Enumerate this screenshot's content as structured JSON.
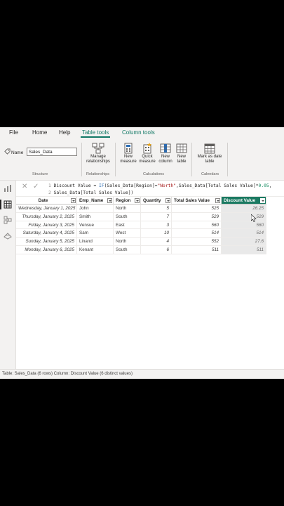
{
  "menu": {
    "items": [
      {
        "label": "File"
      },
      {
        "label": "Home"
      },
      {
        "label": "Help"
      },
      {
        "label": "Table tools"
      },
      {
        "label": "Column tools"
      }
    ],
    "active_index": 3
  },
  "ribbon": {
    "structure": {
      "name_label": "Name",
      "name_value": "Sales_Data",
      "group_label": "Structure"
    },
    "relationships": {
      "button_line1": "Manage",
      "button_line2": "relationships",
      "group_label": "Relationships"
    },
    "calculations": {
      "new_measure": {
        "line1": "New",
        "line2": "measure"
      },
      "quick_measure": {
        "line1": "Quick",
        "line2": "measure"
      },
      "new_column": {
        "line1": "New",
        "line2": "column"
      },
      "new_table": {
        "line1": "New",
        "line2": "table"
      },
      "group_label": "Calculations"
    },
    "calendars": {
      "button_line1": "Mark as date",
      "button_line2": "table",
      "group_label": "Calendars"
    }
  },
  "formula": {
    "line1_num": "1",
    "line1_a": "Discount Value = ",
    "line1_kw": "IF",
    "line1_b": "(Sales_Data[Region]=",
    "line1_str": "\"North\"",
    "line1_c": ",Sales_Data[Total Sales Value]*",
    "line1_num_val": "0.05",
    "line1_d": ",",
    "line2_num": "2",
    "line2_text": "Sales_Data[Total Sales Value])"
  },
  "table": {
    "columns": [
      "Date",
      "Emp_Name",
      "Region",
      "Quantity",
      "Total Sales Value",
      "Discount Value"
    ],
    "selected_column": 5,
    "rows": [
      [
        "Wednesday, January 1, 2025",
        "John",
        "North",
        "5",
        "525",
        "26.25"
      ],
      [
        "Thursday, January 2, 2025",
        "Smith",
        "South",
        "7",
        "529",
        "529"
      ],
      [
        "Friday, January 3, 2025",
        "Vensue",
        "East",
        "3",
        "560",
        "560"
      ],
      [
        "Saturday, January 4, 2025",
        "Sam",
        "West",
        "10",
        "514",
        "514"
      ],
      [
        "Sunday, January 5, 2025",
        "Linand",
        "North",
        "4",
        "552",
        "27.6"
      ],
      [
        "Monday, January 6, 2025",
        "Kenant",
        "South",
        "6",
        "511",
        "511"
      ]
    ]
  },
  "status": {
    "text": "Table: Sales_Data (6 rows) Column: Discount Value (6 distinct values)"
  },
  "colors": {
    "accent": "#117865",
    "selected_header": "#1b7a62"
  },
  "icons": [
    "tag-icon",
    "manage-relationships-icon",
    "new-measure-icon",
    "quick-measure-icon",
    "new-column-icon",
    "new-table-icon",
    "mark-date-table-icon",
    "report-view-icon",
    "table-view-icon",
    "model-view-icon",
    "dax-query-view-icon",
    "cancel-icon",
    "check-icon",
    "dropdown-icon",
    "cursor-icon"
  ]
}
